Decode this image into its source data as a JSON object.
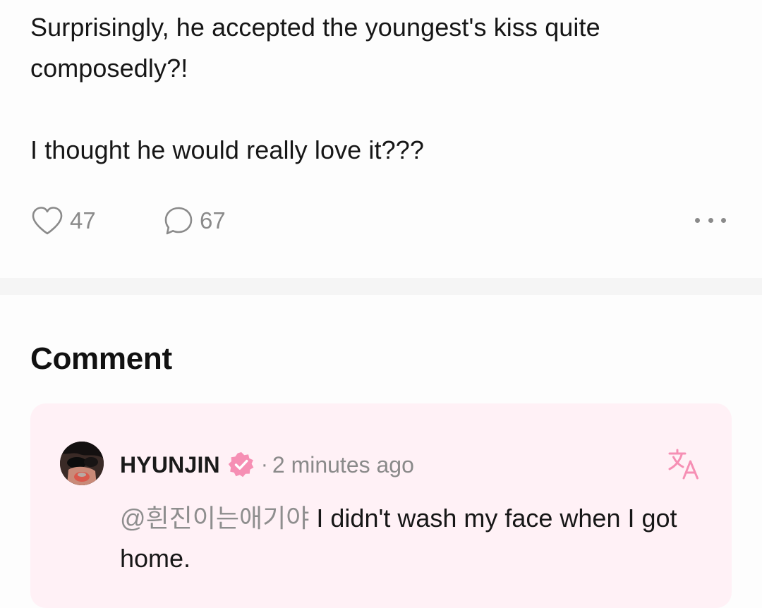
{
  "post": {
    "paragraphs": [
      "Surprisingly, he accepted the youngest's kiss quite composedly?!",
      "I thought he would really love it???"
    ],
    "likes": "47",
    "comments": "67"
  },
  "section": {
    "title": "Comment"
  },
  "comment": {
    "author": "HYUNJIN",
    "separator": "·",
    "time": "2 minutes ago",
    "mention": "@흰진이는애기야",
    "text": " I didn't wash my face when I got home."
  },
  "colors": {
    "accent_pink": "#f68fb4",
    "card_background": "#fff1f6",
    "muted_text": "#8a8a8a",
    "divider": "#f5f5f5"
  },
  "icons": {
    "like": "heart-outline-icon",
    "comment": "speech-bubble-icon",
    "more": "more-horizontal-icon",
    "verified": "verified-badge-icon",
    "translate": "translate-icon"
  }
}
